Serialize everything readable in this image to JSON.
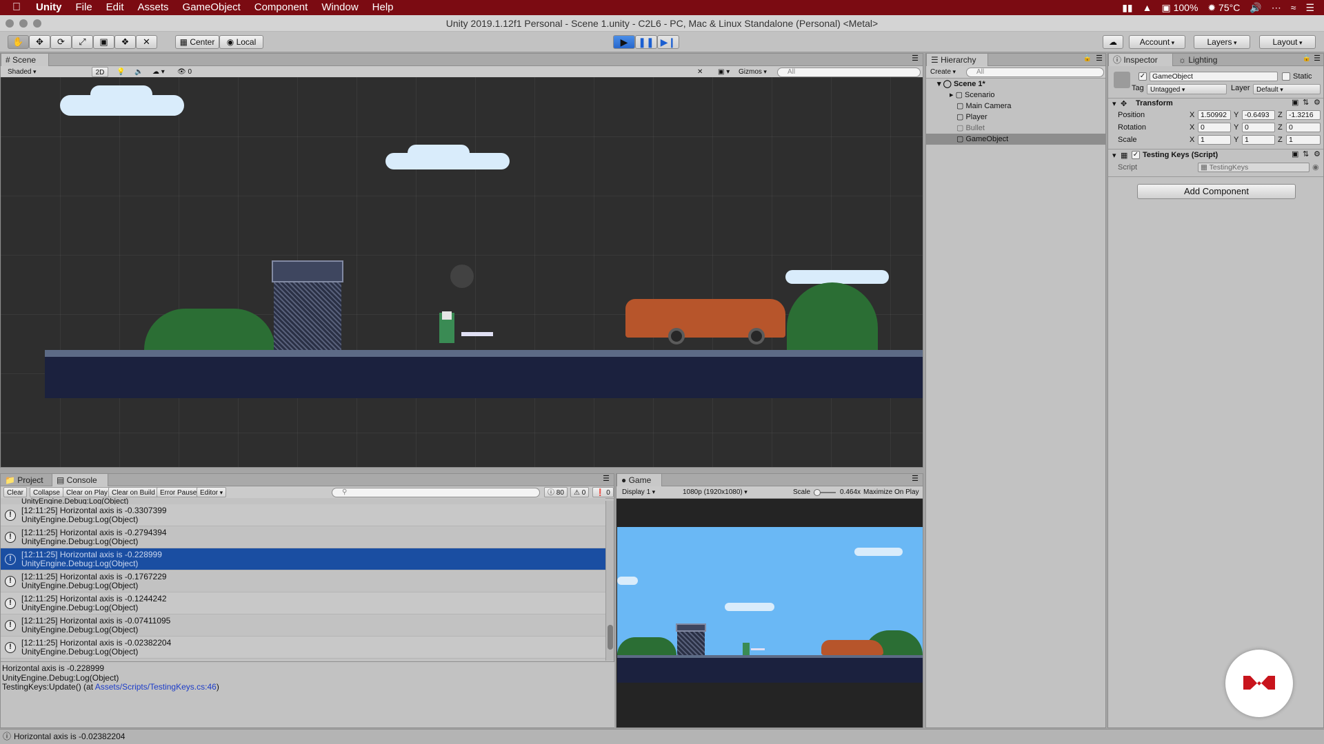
{
  "menubar": {
    "app": "Unity",
    "items": [
      "File",
      "Edit",
      "Assets",
      "GameObject",
      "Component",
      "Window",
      "Help"
    ],
    "battery": "100%",
    "temp": "75°C"
  },
  "window_title": "Unity 2019.1.12f1 Personal - Scene 1.unity - C2L6 - PC, Mac & Linux Standalone (Personal) <Metal>",
  "toolbar": {
    "center": "Center",
    "local": "Local",
    "account": "Account",
    "layers": "Layers",
    "layout": "Layout"
  },
  "scene": {
    "tab": "Scene",
    "shading": "Shaded",
    "mode_2d": "2D",
    "fx_count": "0",
    "gizmos": "Gizmos",
    "search_placeholder": "All"
  },
  "hierarchy": {
    "tab": "Hierarchy",
    "create": "Create",
    "search_placeholder": "All",
    "root": "Scene 1*",
    "items": [
      "Scenario",
      "Main Camera",
      "Player",
      "Bullet",
      "GameObject"
    ]
  },
  "inspector": {
    "tab": "Inspector",
    "lighting_tab": "Lighting",
    "object_name": "GameObject",
    "static_label": "Static",
    "tag_label": "Tag",
    "tag_value": "Untagged",
    "layer_label": "Layer",
    "layer_value": "Default",
    "transform": {
      "title": "Transform",
      "position_label": "Position",
      "rotation_label": "Rotation",
      "scale_label": "Scale",
      "position": {
        "x": "1.50992",
        "y": "-0.6493",
        "z": "-1.3216"
      },
      "rotation": {
        "x": "0",
        "y": "0",
        "z": "0"
      },
      "scale": {
        "x": "1",
        "y": "1",
        "z": "1"
      }
    },
    "script_component": {
      "title": "Testing Keys (Script)",
      "script_label": "Script",
      "script_value": "TestingKeys"
    },
    "add_component": "Add Component"
  },
  "bottom_tabs": {
    "project": "Project",
    "console": "Console",
    "game": "Game"
  },
  "console": {
    "clear": "Clear",
    "collapse": "Collapse",
    "clear_on_play": "Clear on Play",
    "clear_on_build": "Clear on Build",
    "error_pause": "Error Pause",
    "editor": "Editor",
    "log_count": "80",
    "warn_count": "0",
    "error_count": "0",
    "partial_top": "UnityEngine.Debug:Log(Object)",
    "rows": [
      {
        "line1": "[12:11:25] Horizontal axis is -0.3307399",
        "line2": "UnityEngine.Debug:Log(Object)"
      },
      {
        "line1": "[12:11:25] Horizontal axis is -0.2794394",
        "line2": "UnityEngine.Debug:Log(Object)"
      },
      {
        "line1": "[12:11:25] Horizontal axis is -0.228999",
        "line2": "UnityEngine.Debug:Log(Object)"
      },
      {
        "line1": "[12:11:25] Horizontal axis is -0.1767229",
        "line2": "UnityEngine.Debug:Log(Object)"
      },
      {
        "line1": "[12:11:25] Horizontal axis is -0.1244242",
        "line2": "UnityEngine.Debug:Log(Object)"
      },
      {
        "line1": "[12:11:25] Horizontal axis is -0.07411095",
        "line2": "UnityEngine.Debug:Log(Object)"
      },
      {
        "line1": "[12:11:25] Horizontal axis is -0.02382204",
        "line2": "UnityEngine.Debug:Log(Object)"
      }
    ],
    "detail": {
      "line1": "Horizontal axis is -0.228999",
      "line2": "UnityEngine.Debug:Log(Object)",
      "line3_prefix": "TestingKeys:Update() (at ",
      "line3_link": "Assets/Scripts/TestingKeys.cs:46",
      "line3_suffix": ")"
    }
  },
  "game": {
    "display": "Display 1",
    "resolution": "1080p (1920x1080)",
    "scale_label": "Scale",
    "scale_value": "0.464x",
    "maximize": "Maximize On Play"
  },
  "status": "Horizontal axis is -0.02382204",
  "colors": {
    "menubar": "#7b0b12",
    "selection": "#1a4ea2",
    "play_active": "#3a7de0",
    "sky": "#6ab8f5"
  }
}
